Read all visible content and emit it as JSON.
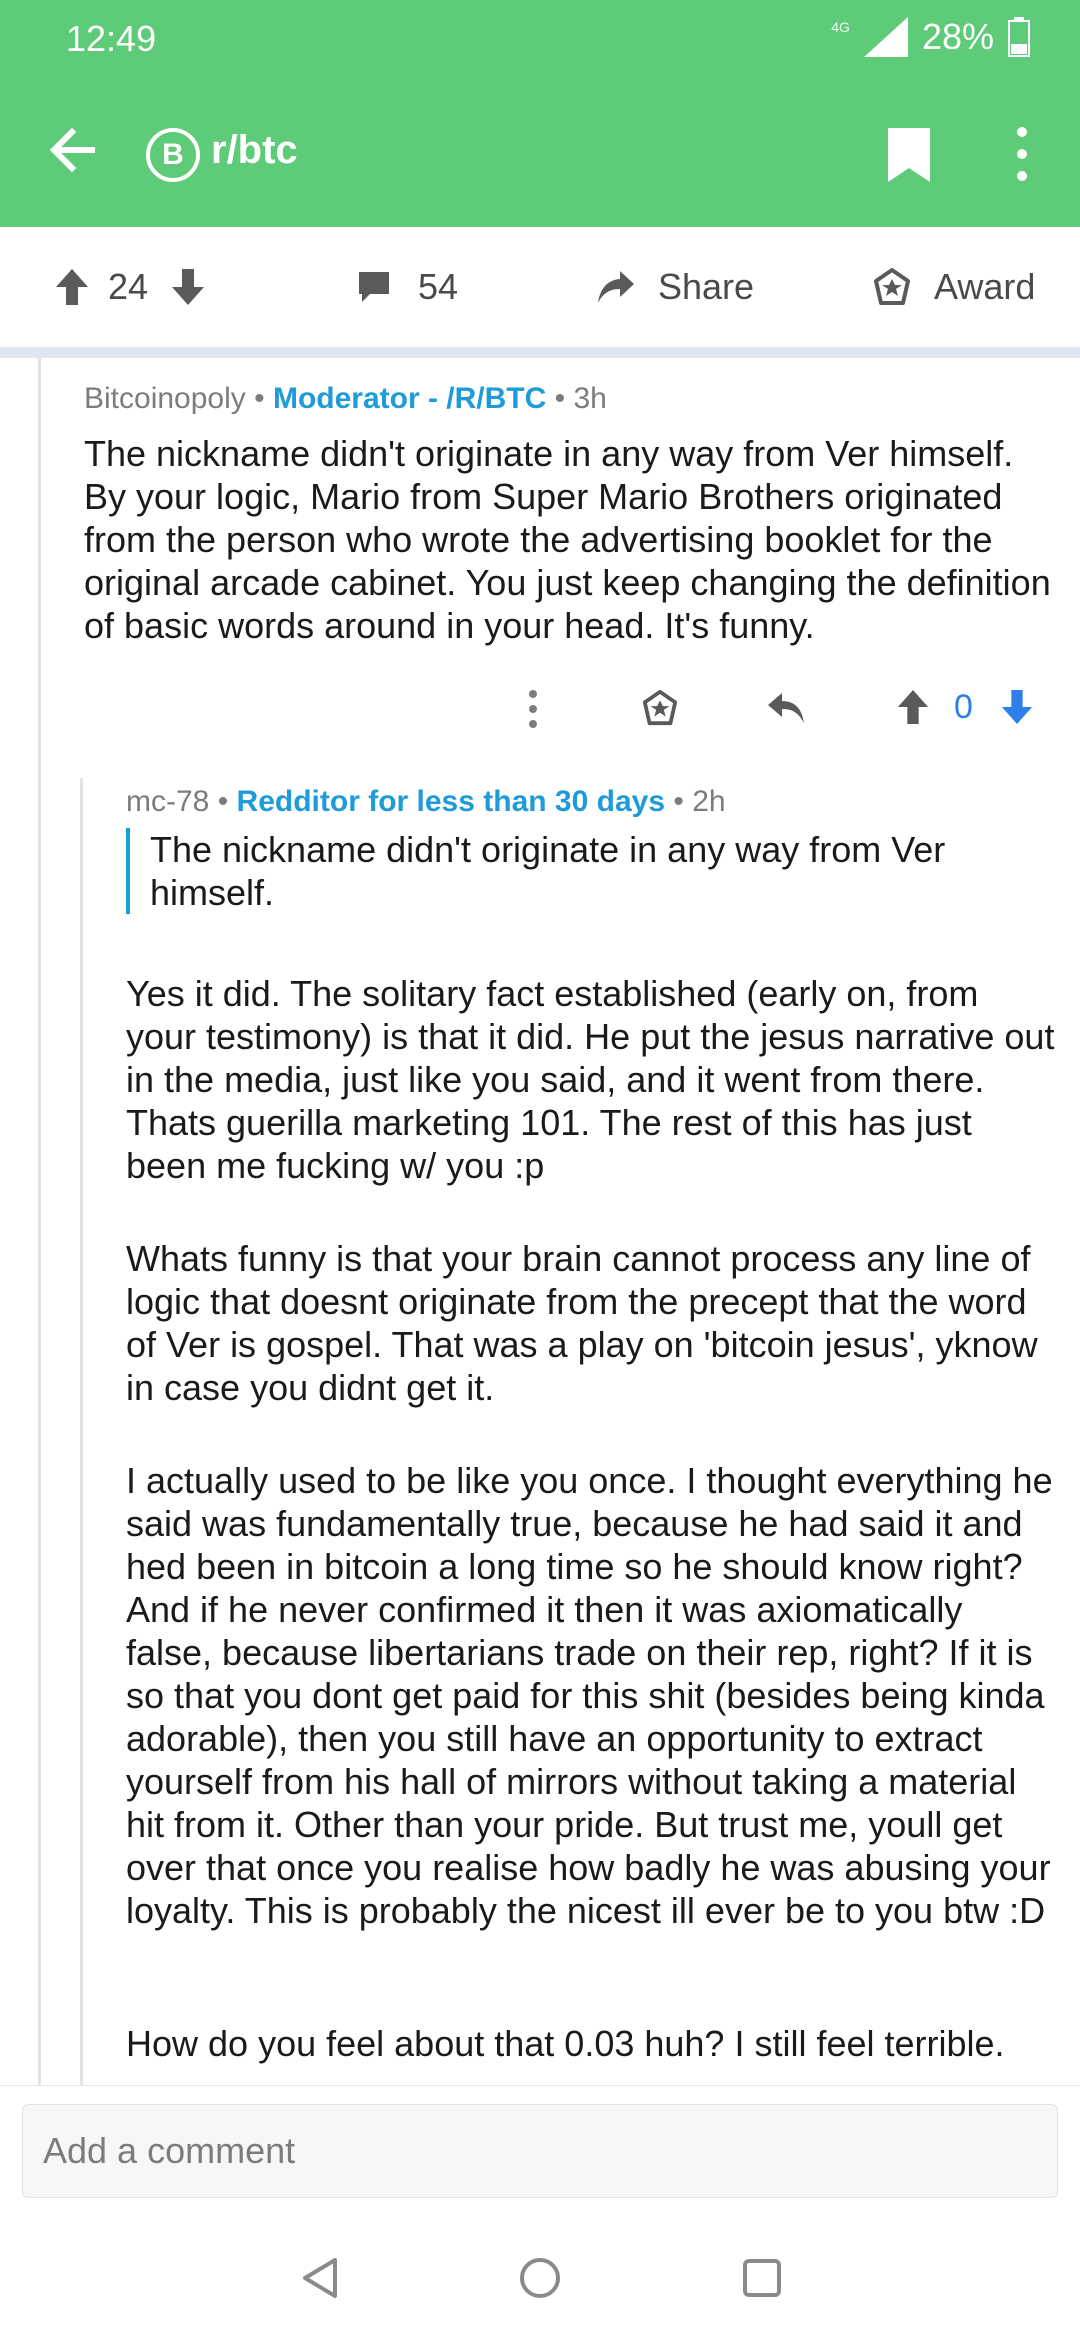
{
  "status_bar": {
    "time": "12:49",
    "network": "4G",
    "battery": "28%",
    "icons": [
      "signal-icon",
      "battery-icon"
    ]
  },
  "header": {
    "subreddit": "r/btc",
    "badge_glyph": "B",
    "accent_color": "#5ecb78",
    "icons": [
      "back-arrow-icon",
      "bitcoin-icon",
      "bookmark-icon",
      "more-vertical-icon"
    ]
  },
  "post_actions": {
    "upvotes": "24",
    "comments": "54",
    "share_label": "Share",
    "award_label": "Award"
  },
  "comments": [
    {
      "author": "Bitcoinopoly",
      "flair": "Moderator - /R/BTC",
      "age": "3h",
      "body": "The nickname didn't originate in any way from Ver himself. By your logic, Mario from Super Mario Brothers originated from the person who wrote the advertising booklet for the original arcade cabinet. You just keep changing the definition of basic words around in your head. It's funny.",
      "score": "0"
    },
    {
      "author": "mc-78",
      "flair": "Redditor for less than 30 days",
      "age": "2h",
      "quote": "The nickname didn't originate in any way from Ver himself.",
      "paragraphs": [
        "Yes it did. The solitary fact established (early on, from your testimony) is that it did. He put the jesus narrative out in the media, just like you said, and it went from there. Thats guerilla marketing 101. The rest of this has just been me fucking w/ you :p",
        "Whats funny is that your brain cannot process any line of logic that doesnt originate from the precept that the word of Ver is gospel. That was a play on 'bitcoin jesus', yknow in case you didnt get it.",
        "I actually used to be like you once. I thought everything he said was fundamentally true, because he had said it and hed been in bitcoin a long time so he should know right? And if he never confirmed it then it was axiomatically false, because libertarians trade on their rep, right? If it is so that you dont get paid for this shit (besides being kinda adorable), then you still have an opportunity to extract yourself from his hall of mirrors without taking a material hit from it. Other than your pride. But trust me, youll get over that once you realise how badly he was abusing your loyalty. This is probably the nicest ill ever be to you btw :D",
        "How do you feel about that 0.03 huh? I still feel terrible."
      ]
    }
  ],
  "composer": {
    "placeholder": "Add a comment"
  },
  "colors": {
    "flair": "#1f9bd9",
    "downvote_active": "#2f7fe8"
  }
}
